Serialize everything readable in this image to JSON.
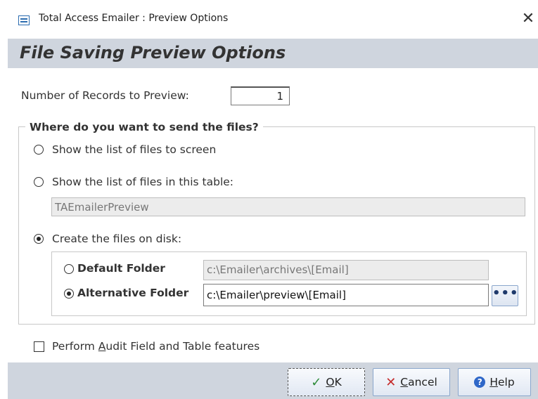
{
  "window": {
    "title": "Total Access Emailer : Preview Options",
    "close_glyph": "✕"
  },
  "header": {
    "title": "File Saving Preview Options"
  },
  "records": {
    "label": "Number of Records to Preview:",
    "value": "1"
  },
  "destination": {
    "legend": "Where do you want to send the files?",
    "opt_screen": "Show the list of files to screen",
    "opt_table": "Show the list of files in this table:",
    "table_name": "TAEmailerPreview",
    "opt_disk": "Create the files on disk:",
    "selected": "disk"
  },
  "folders": {
    "default_label": "Default Folder",
    "default_path": "c:\\Emailer\\archives\\[Email]",
    "alternative_label": "Alternative Folder",
    "alternative_path": "c:\\Emailer\\preview\\[Email]",
    "selected": "alternative",
    "browse_label": "•••"
  },
  "audit": {
    "label_before": "Perform ",
    "label_accel": "A",
    "label_after": "udit Field and Table features",
    "checked": false
  },
  "buttons": {
    "ok_accel": "O",
    "ok_rest": "K",
    "cancel_accel": "C",
    "cancel_rest": "ancel",
    "help_accel": "H",
    "help_rest": "elp"
  },
  "icons": {
    "app": "form-icon",
    "close": "close-icon",
    "ok": "checkmark-icon",
    "cancel": "x-icon",
    "help": "help-icon",
    "browse": "ellipsis-icon"
  },
  "colors": {
    "header_band": "#cfd5de",
    "button_border": "#8aa6cc",
    "help_blue": "#2f67c8",
    "cancel_red": "#c52b2b",
    "ok_green": "#2e8b3a"
  }
}
